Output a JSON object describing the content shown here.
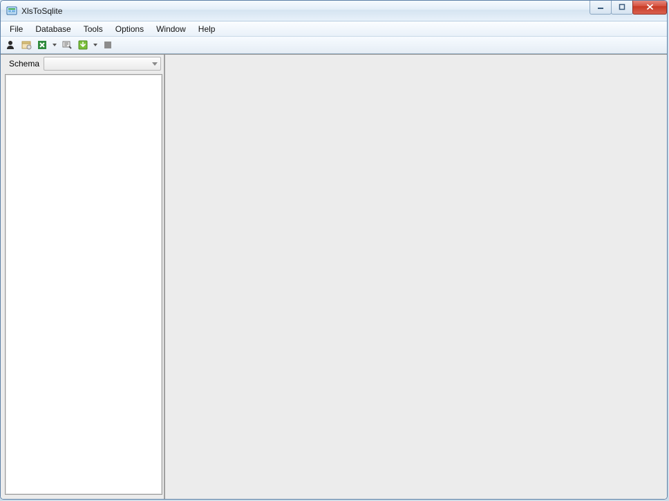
{
  "window": {
    "title": "XlsToSqlite"
  },
  "menu": {
    "items": [
      "File",
      "Database",
      "Tools",
      "Options",
      "Window",
      "Help"
    ]
  },
  "toolbar": {
    "icons": [
      "logon-icon",
      "open-table-icon",
      "excel-icon",
      "excel-dropdown",
      "query-icon",
      "export-icon",
      "export-dropdown",
      "stop-icon"
    ]
  },
  "sidebar": {
    "schema_label": "Schema",
    "schema_value": ""
  }
}
